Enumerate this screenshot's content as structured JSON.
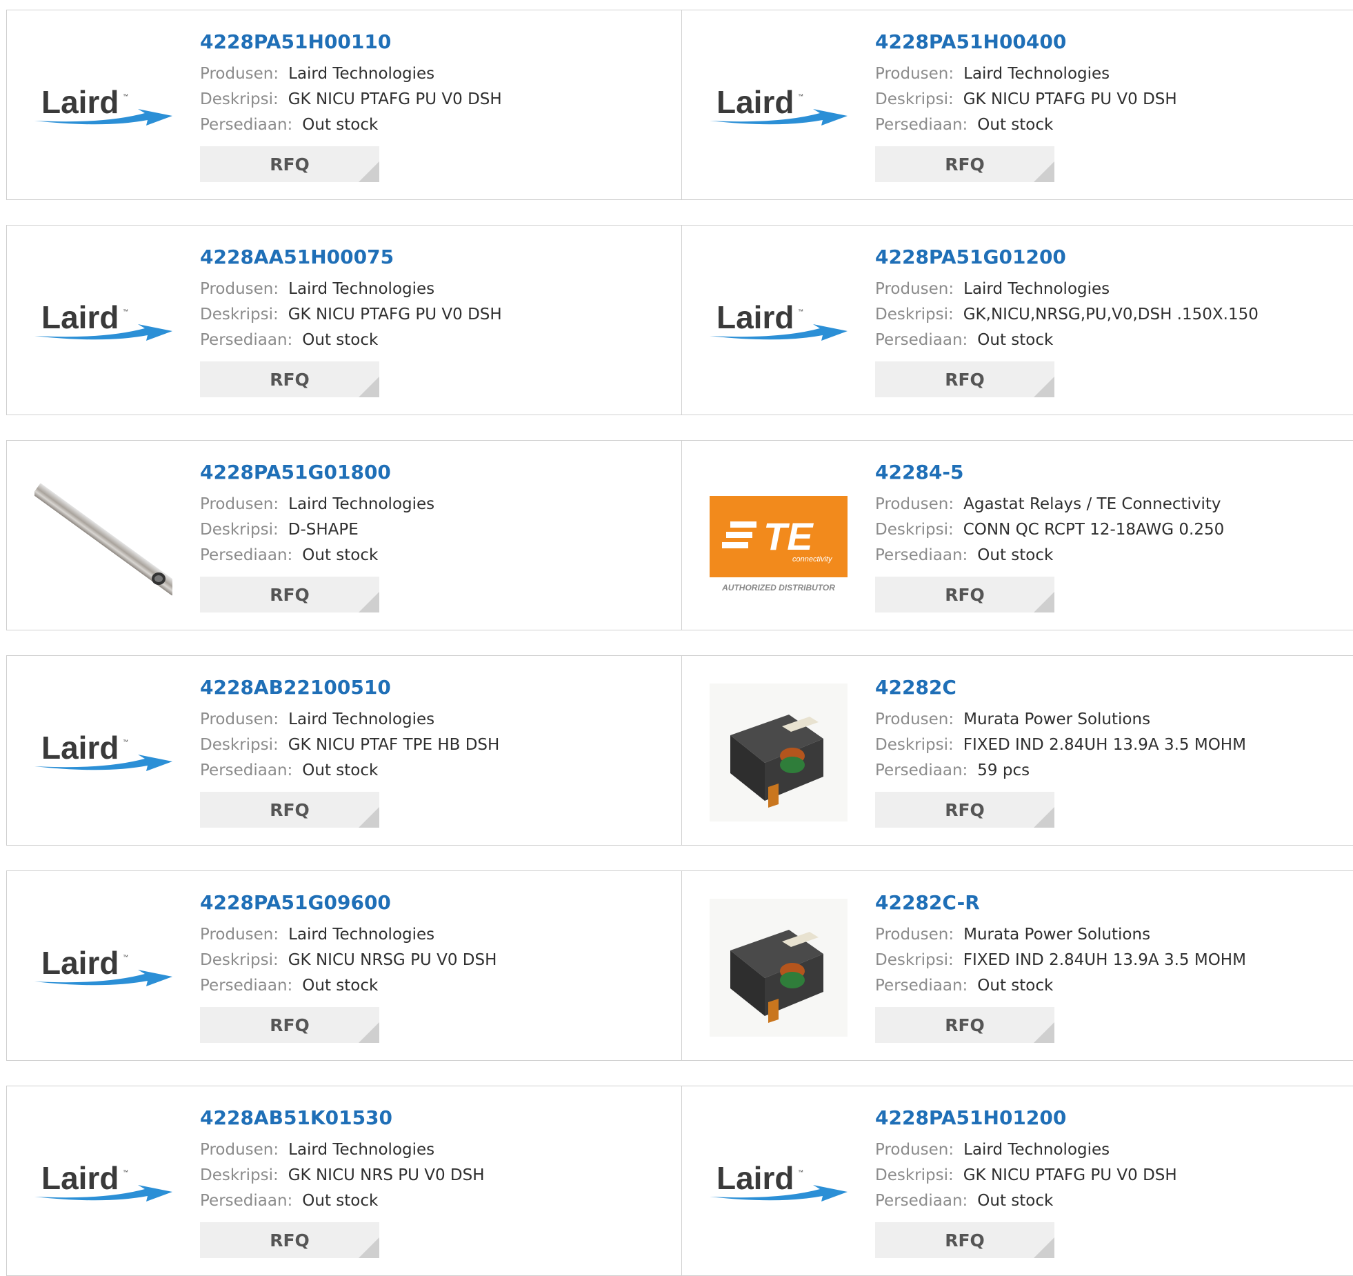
{
  "labels": {
    "manufacturer": "Produsen:",
    "description": "Deskripsi:",
    "stock": "Persediaan:",
    "rfq": "RFQ"
  },
  "products": [
    {
      "part": "4228PA51H00110",
      "manufacturer": "Laird Technologies",
      "description": "GK NICU PTAFG PU V0 DSH",
      "stock": "Out stock",
      "image": "laird-logo"
    },
    {
      "part": "4228PA51H00400",
      "manufacturer": "Laird Technologies",
      "description": "GK NICU PTAFG PU V0 DSH",
      "stock": "Out stock",
      "image": "laird-logo"
    },
    {
      "part": "4228AA51H00075",
      "manufacturer": "Laird Technologies",
      "description": "GK NICU PTAFG PU V0 DSH",
      "stock": "Out stock",
      "image": "laird-logo"
    },
    {
      "part": "4228PA51G01200",
      "manufacturer": "Laird Technologies",
      "description": "GK,NICU,NRSG,PU,V0,DSH .150X.150",
      "stock": "Out stock",
      "image": "laird-logo"
    },
    {
      "part": "4228PA51G01800",
      "manufacturer": "Laird Technologies",
      "description": "D-SHAPE",
      "stock": "Out stock",
      "image": "gasket-rod-photo"
    },
    {
      "part": "42284-5",
      "manufacturer": "Agastat Relays / TE Connectivity",
      "description": "CONN QC RCPT 12-18AWG 0.250",
      "stock": "Out stock",
      "image": "te-logo"
    },
    {
      "part": "4228AB22100510",
      "manufacturer": "Laird Technologies",
      "description": "GK NICU PTAF TPE HB DSH",
      "stock": "Out stock",
      "image": "laird-logo"
    },
    {
      "part": "42282C",
      "manufacturer": "Murata Power Solutions",
      "description": "FIXED IND 2.84UH 13.9A 3.5 MOHM",
      "stock": "59 pcs",
      "image": "inductor-photo"
    },
    {
      "part": "4228PA51G09600",
      "manufacturer": "Laird Technologies",
      "description": "GK NICU NRSG PU V0 DSH",
      "stock": "Out stock",
      "image": "laird-logo"
    },
    {
      "part": "42282C-R",
      "manufacturer": "Murata Power Solutions",
      "description": "FIXED IND 2.84UH 13.9A 3.5 MOHM",
      "stock": "Out stock",
      "image": "inductor-photo"
    },
    {
      "part": "4228AB51K01530",
      "manufacturer": "Laird Technologies",
      "description": "GK NICU NRS PU V0 DSH",
      "stock": "Out stock",
      "image": "laird-logo"
    },
    {
      "part": "4228PA51H01200",
      "manufacturer": "Laird Technologies",
      "description": "GK NICU PTAFG PU V0 DSH",
      "stock": "Out stock",
      "image": "laird-logo"
    }
  ],
  "logos": {
    "laird": {
      "text": "Laird",
      "color": "#3a3a3a",
      "swoosh_color": "#2b8fd6"
    },
    "te": {
      "text": "TE",
      "subtext": "connectivity",
      "caption": "AUTHORIZED DISTRIBUTOR",
      "color": "#f28a1c"
    }
  },
  "colors": {
    "link": "#1f6fb7",
    "label": "#8c8c8c",
    "button_bg": "#efefef",
    "border": "#cfcfcf"
  }
}
